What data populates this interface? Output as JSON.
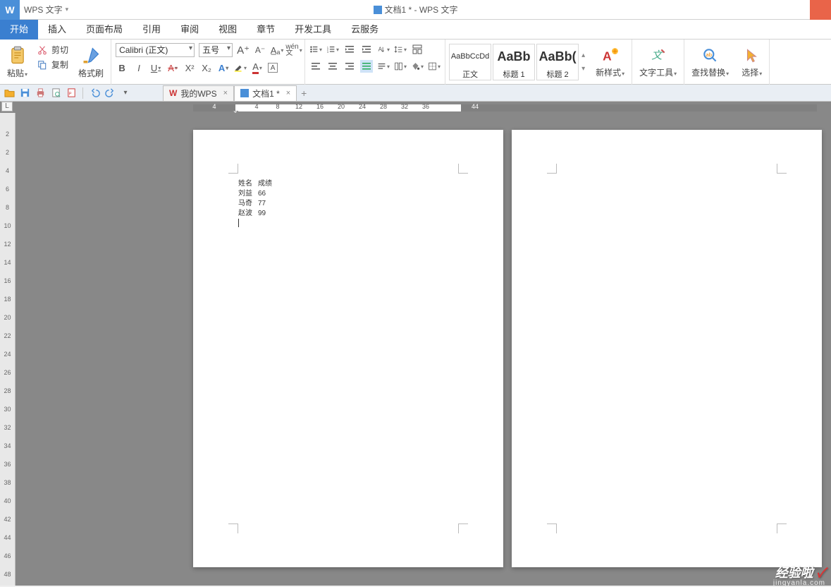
{
  "app": {
    "name": "WPS 文字",
    "window_title": "文档1 * - WPS 文字"
  },
  "menu": {
    "tabs": [
      "开始",
      "插入",
      "页面布局",
      "引用",
      "审阅",
      "视图",
      "章节",
      "开发工具",
      "云服务"
    ],
    "active": 0
  },
  "ribbon": {
    "clipboard": {
      "paste": "粘贴",
      "cut": "剪切",
      "copy": "复制",
      "format_painter": "格式刷"
    },
    "font": {
      "name": "Calibri (正文)",
      "size": "五号"
    },
    "styles": {
      "items": [
        {
          "preview": "AaBbCcDd",
          "big": false,
          "label": "正文"
        },
        {
          "preview": "AaBb",
          "big": true,
          "label": "标题 1"
        },
        {
          "preview": "AaBb(",
          "big": true,
          "label": "标题 2"
        }
      ],
      "new_style": "新样式"
    },
    "tools": {
      "text": "文字工具",
      "find": "查找替换",
      "select": "选择"
    }
  },
  "doctabs": {
    "items": [
      "我的WPS",
      "文档1 *"
    ],
    "active": 1
  },
  "ruler": {
    "h_ticks": [
      4,
      4,
      8,
      12,
      16,
      20,
      24,
      28,
      32,
      36,
      44
    ],
    "v_ticks": [
      2,
      2,
      4,
      6,
      8,
      10,
      12,
      14,
      16,
      18,
      20,
      22,
      24,
      26,
      28,
      30,
      32,
      34,
      36,
      38,
      40,
      42,
      44,
      46,
      48
    ]
  },
  "document": {
    "header_row": [
      "姓名",
      "成绩"
    ],
    "rows": [
      [
        "刘益",
        "66"
      ],
      [
        "马奇",
        "77"
      ],
      [
        "赵波",
        "99"
      ]
    ]
  },
  "watermark": {
    "brand": "经验啦",
    "site": "jingyanla.com"
  }
}
